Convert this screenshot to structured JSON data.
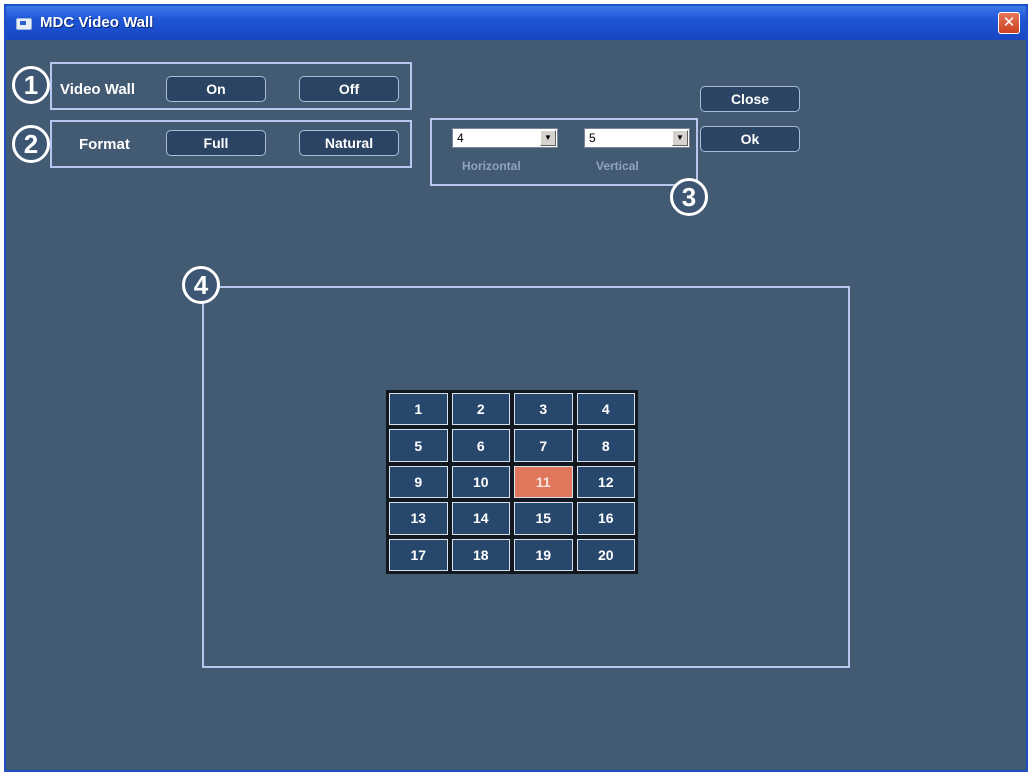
{
  "window": {
    "title": "MDC Video Wall",
    "close_glyph": "✕"
  },
  "badges": [
    "1",
    "2",
    "3",
    "4"
  ],
  "video_wall": {
    "label": "Video Wall",
    "on_label": "On",
    "off_label": "Off"
  },
  "format": {
    "label": "Format",
    "full_label": "Full",
    "natural_label": "Natural"
  },
  "dimensions": {
    "horizontal_value": "4",
    "horizontal_label": "Horizontal",
    "vertical_value": "5",
    "vertical_label": "Vertical"
  },
  "actions": {
    "close_label": "Close",
    "ok_label": "Ok"
  },
  "grid": {
    "cells": [
      "1",
      "2",
      "3",
      "4",
      "5",
      "6",
      "7",
      "8",
      "9",
      "10",
      "11",
      "12",
      "13",
      "14",
      "15",
      "16",
      "17",
      "18",
      "19",
      "20"
    ],
    "selected": "11"
  },
  "colors": {
    "background": "#435a73",
    "selected_cell": "#e0775d",
    "frame": "#b9c7f0",
    "titlebar": "#1f56d6"
  }
}
